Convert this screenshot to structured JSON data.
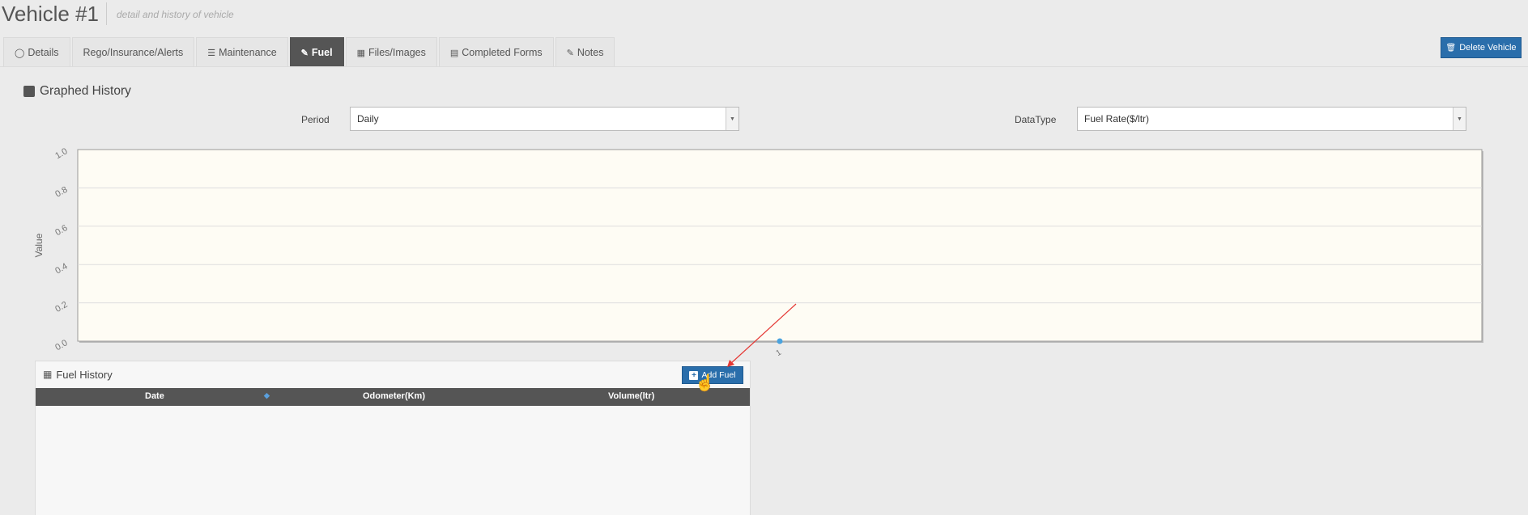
{
  "header": {
    "title": "Vehicle #1",
    "subtitle": "detail and history of vehicle"
  },
  "tabs": [
    {
      "label": "Details",
      "icon": "circle-icon",
      "active": false
    },
    {
      "label": "Rego/Insurance/Alerts",
      "icon": "",
      "active": false
    },
    {
      "label": "Maintenance",
      "icon": "list-icon",
      "active": false
    },
    {
      "label": "Fuel",
      "icon": "pencil-icon",
      "active": true
    },
    {
      "label": "Files/Images",
      "icon": "image-icon",
      "active": false
    },
    {
      "label": "Completed Forms",
      "icon": "form-icon",
      "active": false
    },
    {
      "label": "Notes",
      "icon": "pencil-icon",
      "active": false
    }
  ],
  "actions": {
    "delete_label": "Delete Vehicle",
    "delete_icon": "trash-icon"
  },
  "graph": {
    "heading": "Graphed History",
    "period_label": "Period",
    "period_value": "Daily",
    "datatype_label": "DataType",
    "datatype_value": "Fuel Rate($/ltr)"
  },
  "chart_data": {
    "type": "line",
    "title": "",
    "xlabel": "",
    "ylabel": "Value",
    "x": [
      "1"
    ],
    "series": [
      {
        "values": [
          0
        ]
      }
    ],
    "ylim": [
      0,
      1.0
    ],
    "yticks": [
      "0.0",
      "0.2",
      "0.4",
      "0.6",
      "0.8",
      "1.0"
    ],
    "grid": true,
    "colors": {
      "plot_bg": "#fefcf4",
      "point": "#4aa3df",
      "grid": "#dddddd"
    }
  },
  "fuel_history": {
    "title": "Fuel History",
    "add_label": "Add Fuel",
    "columns": [
      "Date",
      "Odometer(Km)",
      "Volume(ltr)"
    ],
    "rows": []
  },
  "colors": {
    "primary": "#2a6eab",
    "tab_active": "#555555",
    "annotation_arrow": "#e53935"
  }
}
